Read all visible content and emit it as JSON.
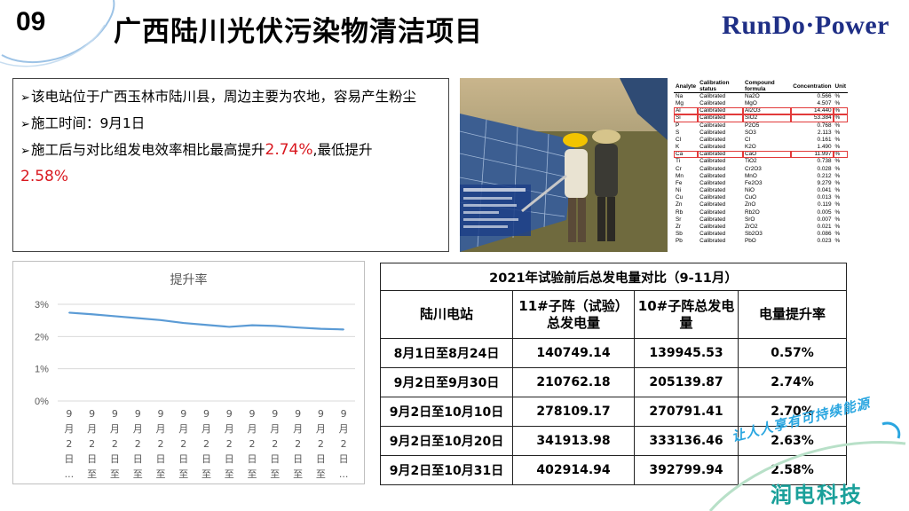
{
  "header": {
    "number": "09",
    "title": "广西陆川光伏污染物清洁项目",
    "logo": "RunDo·Power"
  },
  "info": {
    "bullets": [
      {
        "text": "该电站位于广西玉林市陆川县，周边主要为农地，容易产生粉尘"
      },
      {
        "text": "施工时间：9月1日"
      },
      {
        "text_before": "施工后与对比组发电效率相比最高提升",
        "highlight1": "2.74%",
        "text_mid": ",最低提升",
        "highlight2": "2.58%"
      }
    ]
  },
  "analyte_table": {
    "headers": [
      "Analyte",
      "Calibration status",
      "Compound formula",
      "Concentration",
      "Unit"
    ],
    "rows": [
      [
        "Na",
        "Calibrated",
        "Na2O",
        "0.566",
        "%"
      ],
      [
        "Mg",
        "Calibrated",
        "MgO",
        "4.507",
        "%"
      ],
      [
        "Al",
        "Calibrated",
        "Al2O3",
        "14.440",
        "%"
      ],
      [
        "Si",
        "Calibrated",
        "SiO2",
        "53.384",
        "%"
      ],
      [
        "P",
        "Calibrated",
        "P2O5",
        "0.768",
        "%"
      ],
      [
        "S",
        "Calibrated",
        "SO3",
        "2.113",
        "%"
      ],
      [
        "Cl",
        "Calibrated",
        "Cl",
        "0.161",
        "%"
      ],
      [
        "K",
        "Calibrated",
        "K2O",
        "1.490",
        "%"
      ],
      [
        "Ca",
        "Calibrated",
        "CaO",
        "11.997",
        "%"
      ],
      [
        "Ti",
        "Calibrated",
        "TiO2",
        "0.738",
        "%"
      ],
      [
        "Cr",
        "Calibrated",
        "Cr2O3",
        "0.028",
        "%"
      ],
      [
        "Mn",
        "Calibrated",
        "MnO",
        "0.212",
        "%"
      ],
      [
        "Fe",
        "Calibrated",
        "Fe2O3",
        "9.279",
        "%"
      ],
      [
        "Ni",
        "Calibrated",
        "NiO",
        "0.041",
        "%"
      ],
      [
        "Cu",
        "Calibrated",
        "CuO",
        "0.013",
        "%"
      ],
      [
        "Zn",
        "Calibrated",
        "ZnO",
        "0.119",
        "%"
      ],
      [
        "Rb",
        "Calibrated",
        "Rb2O",
        "0.005",
        "%"
      ],
      [
        "Sr",
        "Calibrated",
        "SrO",
        "0.007",
        "%"
      ],
      [
        "Zr",
        "Calibrated",
        "ZrO2",
        "0.021",
        "%"
      ],
      [
        "Sb",
        "Calibrated",
        "Sb2O3",
        "0.086",
        "%"
      ],
      [
        "Pb",
        "Calibrated",
        "PbO",
        "0.023",
        "%"
      ]
    ],
    "highlighted_rows": [
      2,
      3,
      8
    ]
  },
  "chart_data": {
    "type": "line",
    "title": "提升率",
    "y_ticks": [
      "0%",
      "1%",
      "2%",
      "3%"
    ],
    "ylim": [
      0,
      3
    ],
    "x_labels": [
      [
        "9",
        "月",
        "2",
        "日",
        "..."
      ],
      [
        "9",
        "月",
        "2",
        "日",
        "至"
      ],
      [
        "9",
        "月",
        "2",
        "日",
        "至"
      ],
      [
        "9",
        "月",
        "2",
        "日",
        "至"
      ],
      [
        "9",
        "月",
        "2",
        "日",
        "至"
      ],
      [
        "9",
        "月",
        "2",
        "日",
        "至"
      ],
      [
        "9",
        "月",
        "2",
        "日",
        "至"
      ],
      [
        "9",
        "月",
        "2",
        "日",
        "至"
      ],
      [
        "9",
        "月",
        "2",
        "日",
        "至"
      ],
      [
        "9",
        "月",
        "2",
        "日",
        "至"
      ],
      [
        "9",
        "月",
        "2",
        "日",
        "至"
      ],
      [
        "9",
        "月",
        "2",
        "日",
        "至"
      ],
      [
        "9",
        "月",
        "2",
        "日",
        "..."
      ]
    ],
    "series": [
      {
        "values": [
          2.74,
          2.69,
          2.63,
          2.57,
          2.51,
          2.42,
          2.36,
          2.3,
          2.35,
          2.33,
          2.28,
          2.24,
          2.22
        ],
        "color": "#5b9bd5"
      }
    ],
    "grid": true
  },
  "comparison_table": {
    "caption": "2021年试验前后总发电量对比（9-11月）",
    "headers": [
      "陆川电站",
      "11#子阵（试验）总发电量",
      "10#子阵总发电量",
      "电量提升率"
    ],
    "rows": [
      [
        "8月1日至8月24日",
        "140749.14",
        "139945.53",
        "0.57%"
      ],
      [
        "9月2日至9月30日",
        "210762.18",
        "205139.87",
        "2.74%"
      ],
      [
        "9月2日至10月10日",
        "278109.17",
        "270791.41",
        "2.70%"
      ],
      [
        "9月2日至10月20日",
        "341913.98",
        "333136.46",
        "2.63%"
      ],
      [
        "9月2日至10月31日",
        "402914.94",
        "392799.94",
        "2.58%"
      ]
    ]
  },
  "footer": {
    "slogan": "让人人享有可持续能源",
    "brand": "润电科技"
  },
  "colors": {
    "accent_red": "#d9181f",
    "brand_teal": "#1aa09a",
    "logo_blue": "#1f2f86",
    "line_blue": "#5b9bd5"
  }
}
